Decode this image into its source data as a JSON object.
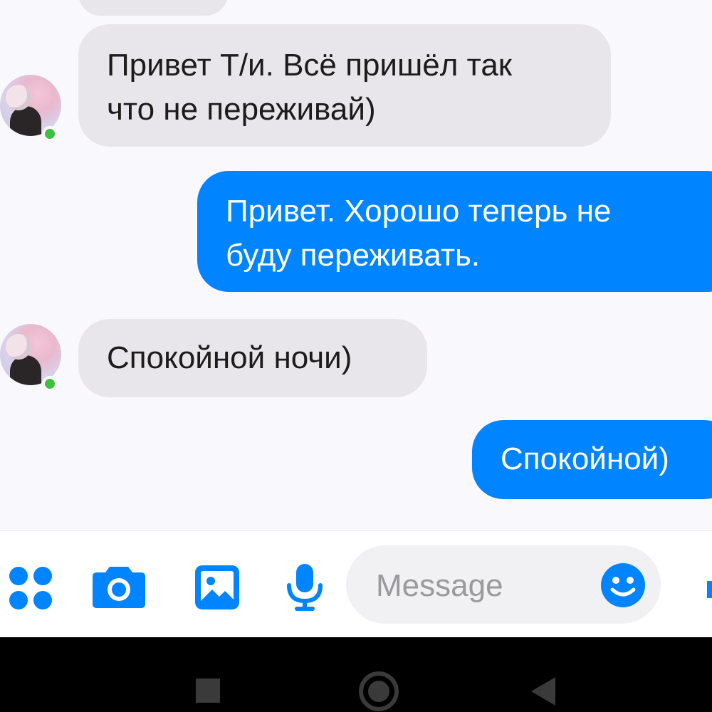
{
  "conversation": {
    "messages": [
      {
        "direction": "incoming",
        "lines": [
          "Привет Т/и. Всё пришёл так",
          "что не переживай)"
        ]
      },
      {
        "direction": "outgoing",
        "lines": [
          "Привет. Хорошо теперь не",
          "буду переживать."
        ]
      },
      {
        "direction": "incoming",
        "lines": [
          "Спокойной ночи)"
        ]
      },
      {
        "direction": "outgoing",
        "lines": [
          "Спокойной)"
        ]
      }
    ]
  },
  "composer": {
    "placeholder": "Message",
    "icons": [
      "apps-grid-icon",
      "camera-icon",
      "gallery-icon",
      "microphone-icon",
      "emoji-icon",
      "send-icon"
    ]
  },
  "navigation_bar": {
    "icons": [
      "recents-square-icon",
      "home-circle-icon",
      "back-triangle-icon"
    ]
  },
  "colors": {
    "accent": "#0084ff",
    "incoming_bubble": "#e8e6ea",
    "background": "#f9f8fc",
    "presence": "#3ec13e"
  }
}
